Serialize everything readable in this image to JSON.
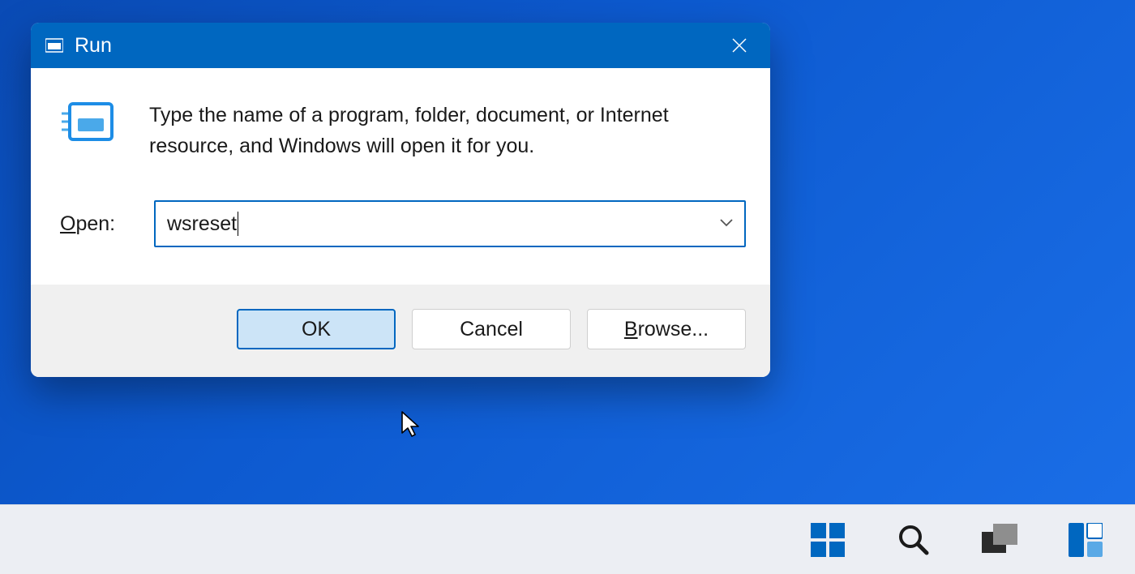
{
  "dialog": {
    "title": "Run",
    "description": "Type the name of a program, folder, document, or Internet resource, and Windows will open it for you.",
    "open_label_prefix": "O",
    "open_label_rest": "pen:",
    "input_value": "wsreset",
    "buttons": {
      "ok": "OK",
      "cancel": "Cancel",
      "browse_prefix": "B",
      "browse_rest": "rowse..."
    }
  }
}
